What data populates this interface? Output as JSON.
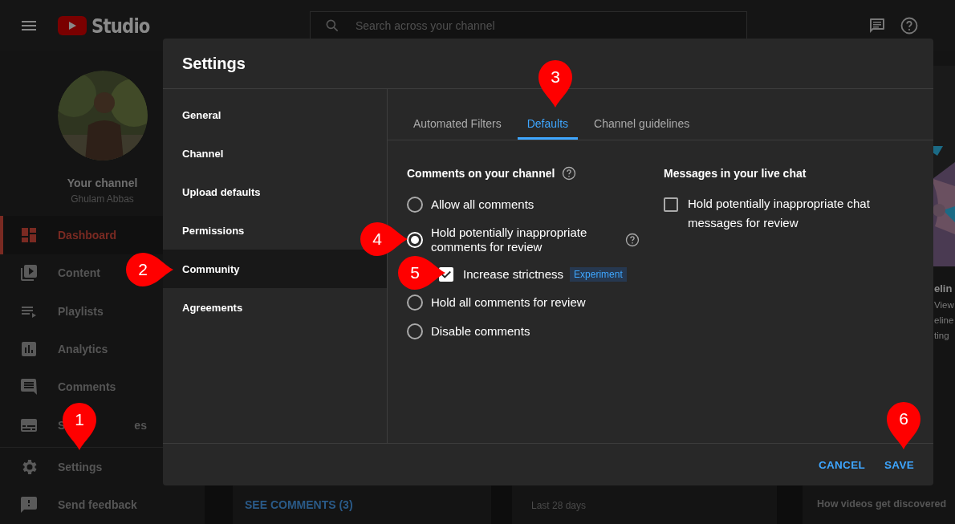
{
  "topbar": {
    "logo_text": "Studio",
    "search": {
      "placeholder": "Search across your channel"
    }
  },
  "channel": {
    "title": "Your channel",
    "name": "Ghulam Abbas"
  },
  "sidebar": {
    "items": [
      {
        "label": "Dashboard",
        "selected": true
      },
      {
        "label": "Content",
        "selected": false
      },
      {
        "label": "Playlists",
        "selected": false
      },
      {
        "label": "Analytics",
        "selected": false
      },
      {
        "label": "Comments",
        "selected": false
      },
      {
        "label": "S",
        "label_tail": "es",
        "selected": false
      }
    ],
    "footer_items": [
      {
        "label": "Settings",
        "selected": false
      },
      {
        "label": "Send feedback",
        "selected": false
      }
    ]
  },
  "background": {
    "comments_link": "SEE COMMENTS (3)",
    "summary_period": "Last 28 days",
    "side_card": {
      "kind": "picture",
      "title": "elin",
      "lines": [
        "View",
        "eline",
        "ting"
      ]
    },
    "discovery_title": "How videos get discovered"
  },
  "dialog": {
    "title": "Settings",
    "nav": [
      {
        "label": "General",
        "selected": false
      },
      {
        "label": "Channel",
        "selected": false
      },
      {
        "label": "Upload defaults",
        "selected": false
      },
      {
        "label": "Permissions",
        "selected": false
      },
      {
        "label": "Community",
        "selected": true
      },
      {
        "label": "Agreements",
        "selected": false
      }
    ],
    "tabs": [
      {
        "label": "Automated Filters",
        "selected": false
      },
      {
        "label": "Defaults",
        "selected": true
      },
      {
        "label": "Channel guidelines",
        "selected": false
      }
    ],
    "comments_section": {
      "title": "Comments on your channel",
      "help": true,
      "options": [
        {
          "kind": "radio",
          "label": "Allow all comments",
          "selected": false
        },
        {
          "kind": "radio",
          "label": "Hold potentially inappropriate comments for review",
          "selected": true,
          "help": true
        },
        {
          "kind": "checkbox",
          "label": "Increase strictness",
          "checked": true,
          "badge": "Experiment"
        },
        {
          "kind": "radio",
          "label": "Hold all comments for review",
          "selected": false
        },
        {
          "kind": "radio",
          "label": "Disable comments",
          "selected": false
        }
      ]
    },
    "chat_section": {
      "title": "Messages in your live chat",
      "options": [
        {
          "label": "Hold potentially inappropriate chat messages for review",
          "checked": false
        }
      ]
    },
    "buttons": [
      {
        "label": "CANCEL"
      },
      {
        "label": "SAVE"
      }
    ]
  },
  "annotations": [
    {
      "label": "1"
    },
    {
      "label": "2"
    },
    {
      "label": "3"
    },
    {
      "label": "4"
    },
    {
      "label": "5"
    },
    {
      "label": "6"
    }
  ]
}
